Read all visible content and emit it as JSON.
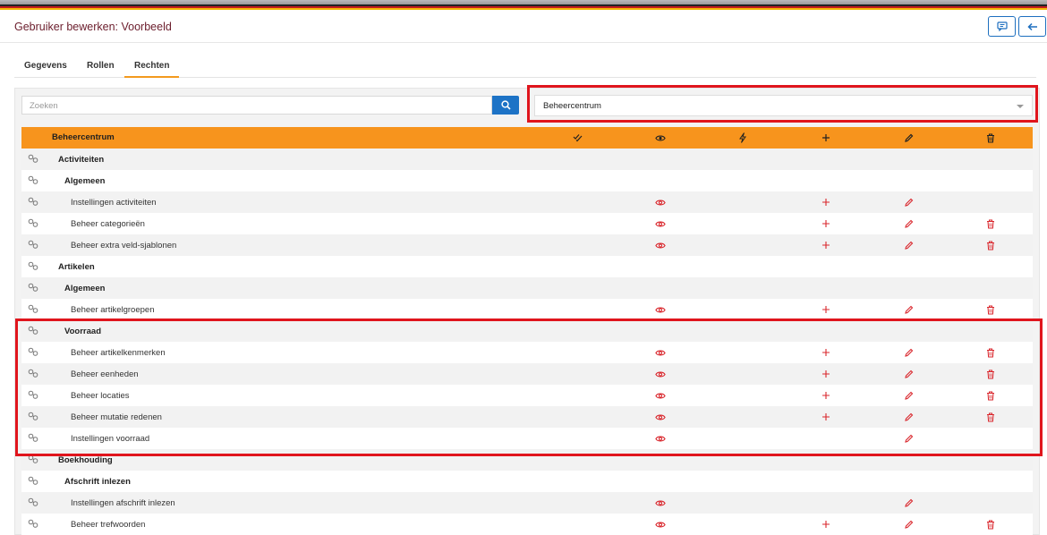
{
  "header": {
    "title": "Gebruiker bewerken: Voorbeeld",
    "btn_comment_icon": "comment-icon",
    "btn_back_icon": "arrow-left-icon"
  },
  "tabs": [
    {
      "label": "Gegevens"
    },
    {
      "label": "Rollen"
    },
    {
      "label": "Rechten",
      "active": true
    }
  ],
  "search": {
    "placeholder": "Zoeken",
    "button_icon": "search-icon"
  },
  "module_select": {
    "value": "Beheercentrum"
  },
  "table": {
    "header_title": "Beheercentrum",
    "columns": [
      "check-all-icon",
      "eye-icon",
      "bolt-icon",
      "plus-icon",
      "pencil-icon",
      "trash-icon"
    ],
    "rows": [
      {
        "label": "Activiteiten",
        "level": 1,
        "perms": []
      },
      {
        "label": "Algemeen",
        "level": 2,
        "perms": []
      },
      {
        "label": "Instellingen activiteiten",
        "level": 3,
        "perms": [
          "view",
          "add",
          "edit"
        ]
      },
      {
        "label": "Beheer categorieën",
        "level": 3,
        "perms": [
          "view",
          "add",
          "edit",
          "delete"
        ]
      },
      {
        "label": "Beheer extra veld-sjablonen",
        "level": 3,
        "perms": [
          "view",
          "add",
          "edit",
          "delete"
        ]
      },
      {
        "label": "Artikelen",
        "level": 1,
        "perms": []
      },
      {
        "label": "Algemeen",
        "level": 2,
        "perms": []
      },
      {
        "label": "Beheer artikelgroepen",
        "level": 3,
        "perms": [
          "view",
          "add",
          "edit",
          "delete"
        ]
      },
      {
        "label": "Voorraad",
        "level": 2,
        "perms": []
      },
      {
        "label": "Beheer artikelkenmerken",
        "level": 3,
        "perms": [
          "view",
          "add",
          "edit",
          "delete"
        ]
      },
      {
        "label": "Beheer eenheden",
        "level": 3,
        "perms": [
          "view",
          "add",
          "edit",
          "delete"
        ]
      },
      {
        "label": "Beheer locaties",
        "level": 3,
        "perms": [
          "view",
          "add",
          "edit",
          "delete"
        ]
      },
      {
        "label": "Beheer mutatie redenen",
        "level": 3,
        "perms": [
          "view",
          "add",
          "edit",
          "delete"
        ]
      },
      {
        "label": "Instellingen voorraad",
        "level": 3,
        "perms": [
          "view",
          "edit"
        ]
      },
      {
        "label": "Boekhouding",
        "level": 1,
        "perms": []
      },
      {
        "label": "Afschrift inlezen",
        "level": 2,
        "perms": []
      },
      {
        "label": "Instellingen afschrift inlezen",
        "level": 3,
        "perms": [
          "view",
          "edit"
        ]
      },
      {
        "label": "Beheer trefwoorden",
        "level": 3,
        "perms": [
          "view",
          "add",
          "edit",
          "delete"
        ]
      }
    ]
  },
  "colors": {
    "accent": "#f7941d",
    "primary": "#1d73c6",
    "permission_icon": "#d9262c",
    "highlight_box": "#e0151d"
  }
}
